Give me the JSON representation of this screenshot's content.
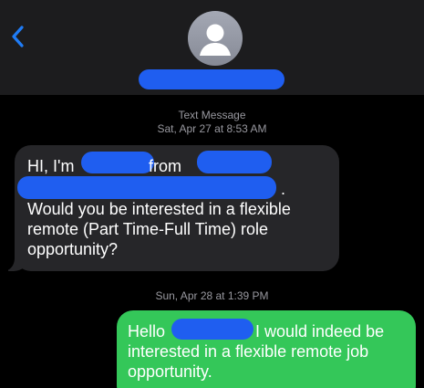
{
  "header": {
    "back_icon": "chevron-left-icon",
    "avatar_icon": "person-silhouette-icon",
    "accent_color": "#1f5ef0"
  },
  "thread": {
    "service_label": "Text Message",
    "first_timestamp": "Sat, Apr 27 at 8:53 AM",
    "second_timestamp": "Sun, Apr 28 at 1:39 PM"
  },
  "incoming_message": {
    "line1_start": "HI, I'm ",
    "line1_mid": " from",
    "line2_end": ".",
    "line3": "Would you be interested in a flexible",
    "line4": "remote (Part Time-Full Time) role",
    "line5": "opportunity?"
  },
  "outgoing_message": {
    "line1_start": "Hello",
    "line1_end": "I would indeed be",
    "line2": "interested in a flexible remote job",
    "line3": "opportunity."
  },
  "colors": {
    "header_background": "#1c1c1e",
    "incoming_bubble": "#262629",
    "outgoing_bubble": "#34c759",
    "timestamp_text": "#98989f",
    "redaction": "#1f5ef0"
  }
}
